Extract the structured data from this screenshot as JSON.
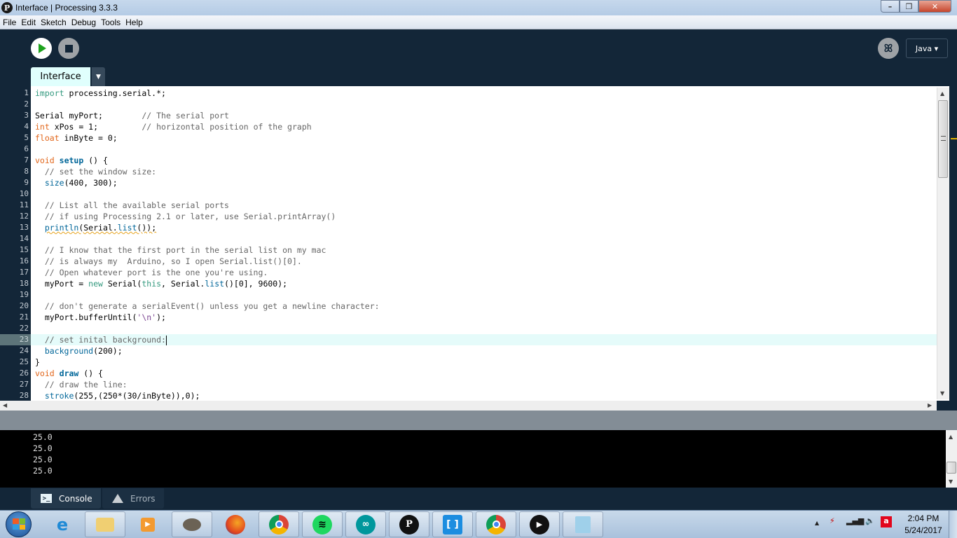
{
  "window": {
    "title": "Interface | Processing 3.3.3",
    "app_icon": "P3"
  },
  "menu": [
    "File",
    "Edit",
    "Sketch",
    "Debug",
    "Tools",
    "Help"
  ],
  "toolbar": {
    "run": "run-icon",
    "stop": "stop-icon",
    "debug": "debugger-icon",
    "mode": "Java ▾"
  },
  "tabs": [
    {
      "label": "Interface"
    }
  ],
  "editor": {
    "current_line": 23,
    "lines": [
      {
        "n": "1",
        "t": [
          [
            "kw",
            "import"
          ],
          [
            "",
            " processing.serial.*;"
          ]
        ]
      },
      {
        "n": "2",
        "t": []
      },
      {
        "n": "3",
        "t": [
          [
            "",
            "Serial myPort;        "
          ],
          [
            "cm",
            "// The serial port"
          ]
        ]
      },
      {
        "n": "4",
        "t": [
          [
            "ty",
            "int"
          ],
          [
            "",
            " xPos = 1;         "
          ],
          [
            "cm",
            "// horizontal position of the graph"
          ]
        ]
      },
      {
        "n": "5",
        "t": [
          [
            "ty",
            "float"
          ],
          [
            "",
            " inByte = 0;"
          ]
        ]
      },
      {
        "n": "6",
        "t": []
      },
      {
        "n": "7",
        "t": [
          [
            "ty",
            "void"
          ],
          [
            "",
            " "
          ],
          [
            "fb",
            "setup"
          ],
          [
            "",
            " () {"
          ]
        ]
      },
      {
        "n": "8",
        "t": [
          [
            "cm",
            "  // set the window size:"
          ]
        ]
      },
      {
        "n": "9",
        "t": [
          [
            "",
            "  "
          ],
          [
            "fn",
            "size"
          ],
          [
            "",
            "(400, 300);"
          ]
        ]
      },
      {
        "n": "10",
        "t": []
      },
      {
        "n": "11",
        "t": [
          [
            "cm",
            "  // List all the available serial ports"
          ]
        ]
      },
      {
        "n": "12",
        "t": [
          [
            "cm",
            "  // if using Processing 2.1 or later, use Serial.printArray()"
          ]
        ]
      },
      {
        "n": "13",
        "t": [
          [
            "",
            "  "
          ],
          [
            "fn squig",
            "println"
          ],
          [
            "squig",
            "(Serial."
          ],
          [
            "fn squig",
            "list"
          ],
          [
            "squig",
            "());"
          ]
        ]
      },
      {
        "n": "14",
        "t": []
      },
      {
        "n": "15",
        "t": [
          [
            "cm",
            "  // I know that the first port in the serial list on my mac"
          ]
        ]
      },
      {
        "n": "16",
        "t": [
          [
            "cm",
            "  // is always my  Arduino, so I open Serial.list()[0]."
          ]
        ]
      },
      {
        "n": "17",
        "t": [
          [
            "cm",
            "  // Open whatever port is the one you're using."
          ]
        ]
      },
      {
        "n": "18",
        "t": [
          [
            "",
            "  myPort = "
          ],
          [
            "kw",
            "new"
          ],
          [
            "",
            " Serial("
          ],
          [
            "kw",
            "this"
          ],
          [
            "",
            ", Serial."
          ],
          [
            "fn",
            "list"
          ],
          [
            "",
            "()[0], 9600);"
          ]
        ]
      },
      {
        "n": "19",
        "t": []
      },
      {
        "n": "20",
        "t": [
          [
            "cm",
            "  // don't generate a serialEvent() unless you get a newline character:"
          ]
        ]
      },
      {
        "n": "21",
        "t": [
          [
            "",
            "  myPort.bufferUntil("
          ],
          [
            "st",
            "'\\n'"
          ],
          [
            "",
            ");"
          ]
        ]
      },
      {
        "n": "22",
        "t": []
      },
      {
        "n": "23",
        "t": [
          [
            "cm",
            "  // set inital background:"
          ]
        ]
      },
      {
        "n": "24",
        "t": [
          [
            "",
            "  "
          ],
          [
            "fn",
            "background"
          ],
          [
            "",
            "(200);"
          ]
        ]
      },
      {
        "n": "25",
        "t": [
          [
            "",
            "}"
          ]
        ]
      },
      {
        "n": "26",
        "t": [
          [
            "ty",
            "void"
          ],
          [
            "",
            " "
          ],
          [
            "fb",
            "draw"
          ],
          [
            "",
            " () {"
          ]
        ]
      },
      {
        "n": "27",
        "t": [
          [
            "cm",
            "  // draw the line:"
          ]
        ]
      },
      {
        "n": "28",
        "t": [
          [
            "",
            "  "
          ],
          [
            "fn",
            "stroke"
          ],
          [
            "",
            "(255,(250*(30/inByte)),0);"
          ]
        ]
      }
    ]
  },
  "console": {
    "lines": [
      "25.0",
      "25.0",
      "25.0",
      "25.0"
    ]
  },
  "footer_tabs": {
    "console": "Console",
    "errors": "Errors"
  },
  "taskbar": {
    "items": [
      "Internet Explorer",
      "File Explorer",
      "Windows Media Player",
      "GIMP",
      "Firefox",
      "Chrome",
      "Spotify",
      "Arduino",
      "Processing",
      "Brackets",
      "Chrome",
      "Media Player",
      "Notepad"
    ],
    "time": "2:04 PM",
    "date": "5/24/2017"
  }
}
